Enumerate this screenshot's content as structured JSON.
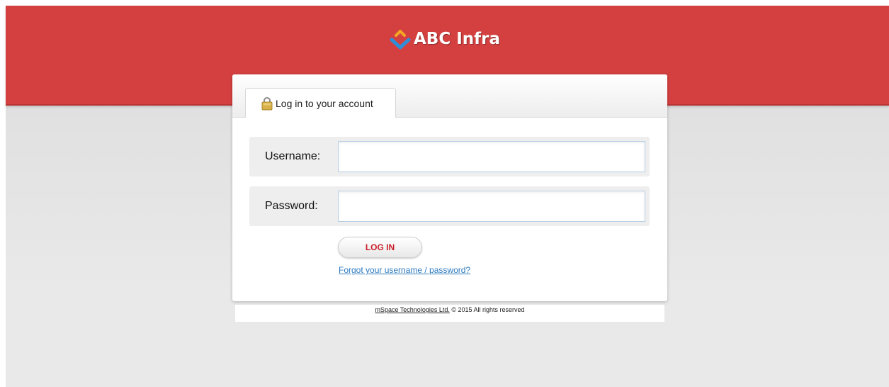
{
  "brand": {
    "name": "ABC Infra",
    "logo_icon": "diamond-chevron-logo",
    "colors": {
      "header": "#d44040",
      "logo_top": "#f5a623",
      "logo_bottom": "#2f8fd8",
      "button_text": "#c8202a",
      "link": "#2f7bbf"
    }
  },
  "panel": {
    "tab_label": "Log in to your account",
    "tab_icon": "padlock-icon"
  },
  "form": {
    "username_label": "Username:",
    "username_value": "",
    "password_label": "Password:",
    "password_value": "",
    "login_button": "LOG IN",
    "forgot_link": "Forgot your username / password?"
  },
  "footer": {
    "company_link": "mSpace Technologies Ltd.",
    "copyright": "© 2015 All rights reserved"
  }
}
